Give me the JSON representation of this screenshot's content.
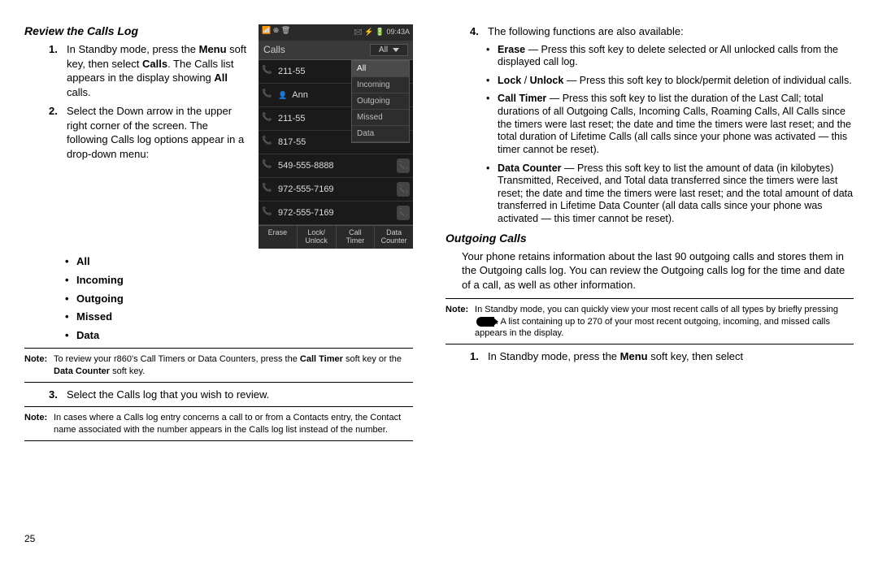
{
  "pageNumber": "25",
  "left": {
    "heading": "Review the Calls Log",
    "step1": {
      "n": "1.",
      "text_pre": "In Standby mode, press the ",
      "menu": "Menu",
      "text_mid1": " soft key, then select ",
      "calls": "Calls",
      "text_mid2": ". The Calls list appears in the display showing ",
      "all": "All",
      "text_post": " calls."
    },
    "step2": {
      "n": "2.",
      "text": "Select the Down arrow in the upper right corner of the screen. The following Calls log options appear in a drop-down menu:"
    },
    "options": {
      "all": "All",
      "incoming": "Incoming",
      "outgoing": "Outgoing",
      "missed": "Missed",
      "data": "Data"
    },
    "note1": {
      "label": "Note:",
      "pre": "To review your r860's Call Timers or Data Counters, press the ",
      "ct": "Call Timer",
      "mid": " soft key or the ",
      "dc": "Data Counter",
      "post": " soft key."
    },
    "step3": {
      "n": "3.",
      "text": "Select the Calls log that you wish to review."
    },
    "note2": {
      "label": "Note:",
      "text": "In cases where a Calls log entry concerns a call to or from a Contacts entry, the Contact name associated with the number appears in the Calls log list instead of the number."
    }
  },
  "right": {
    "step4": {
      "n": "4.",
      "text": "The following functions are also available:"
    },
    "funcs": {
      "erase": {
        "b": "Erase",
        "t": " — Press this soft key to delete selected or All unlocked calls from the displayed call log."
      },
      "lock": {
        "b1": "Lock",
        "sep": " / ",
        "b2": "Unlock",
        "t": " — Press this soft key to block/permit deletion of individual calls."
      },
      "timer": {
        "b": "Call Timer",
        "t": " — Press this soft key to list the duration of the Last Call; total durations of all Outgoing Calls, Incoming Calls, Roaming Calls, All Calls since the timers were last reset; the date and time the timers were last reset; and the total duration of Lifetime Calls (all calls since your phone was activated — this timer cannot be reset)."
      },
      "data": {
        "b": "Data Counter",
        "t": " — Press this soft key to list the amount of data (in kilobytes) Transmitted, Received, and Total data transferred since the timers were last reset; the date and time the timers were last reset; and the total amount of data transferred in Lifetime Data Counter (all data calls since your phone was activated — this timer cannot be reset)."
      }
    },
    "heading2": "Outgoing Calls",
    "para2": "Your phone retains information about the last 90 outgoing calls and stores them in the Outgoing calls log. You can review the Outgoing calls log for the time and date of a call, as well as other information.",
    "note3": {
      "label": "Note:",
      "pre": "In Standby mode, you can quickly view your most recent calls of all types by briefly pressing ",
      "post": ". A list containing up to 270 of your most recent outgoing, incoming, and missed calls appears in the display."
    },
    "step1b": {
      "n": "1.",
      "pre": "In Standby mode, press the ",
      "menu": "Menu",
      "post": " soft key, then select"
    }
  },
  "phone": {
    "status_left": "📶   ⊕ 🗑",
    "status_right": "🖂 ⚡ 🔋 09:43A",
    "title": "Calls",
    "filter": "All",
    "rows": [
      {
        "num": "211-55",
        "contact": false,
        "dial": false
      },
      {
        "num": "Ann",
        "contact": true,
        "dial": false
      },
      {
        "num": "211-55",
        "contact": false,
        "dial": false
      },
      {
        "num": "817-55",
        "contact": false,
        "dial": false
      },
      {
        "num": "549-555-8888",
        "contact": false,
        "dial": true
      },
      {
        "num": "972-555-7169",
        "contact": false,
        "dial": true
      },
      {
        "num": "972-555-7169",
        "contact": false,
        "dial": true
      }
    ],
    "dropdown": [
      "All",
      "Incoming",
      "Outgoing",
      "Missed",
      "Data"
    ],
    "softkeys": [
      "Erase",
      "Lock/\nUnlock",
      "Call\nTimer",
      "Data\nCounter"
    ]
  }
}
